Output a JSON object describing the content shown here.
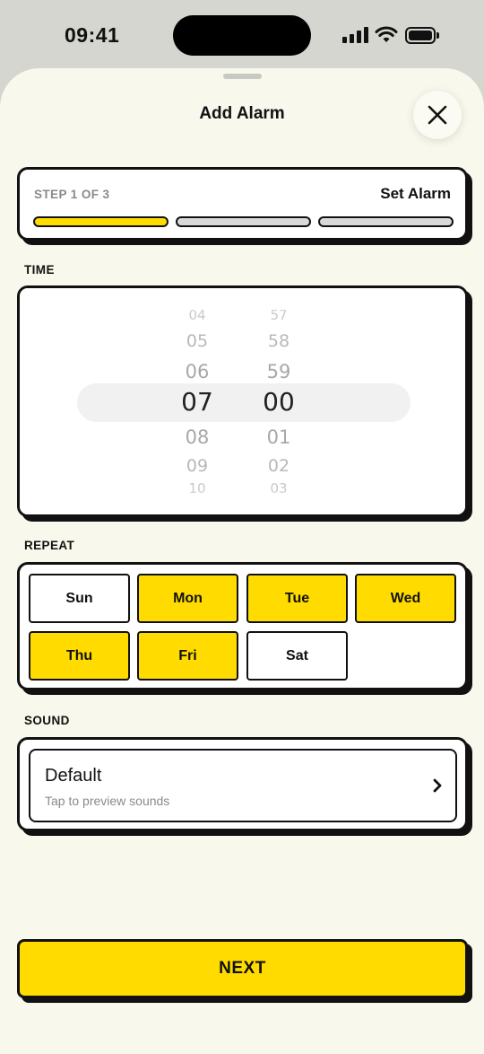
{
  "status_bar": {
    "time": "09:41"
  },
  "sheet": {
    "title": "Add Alarm"
  },
  "step": {
    "label": "STEP 1 OF 3",
    "title": "Set Alarm",
    "current": 1,
    "total": 3
  },
  "time_section": {
    "label": "TIME",
    "hours": {
      "above": [
        "04",
        "05",
        "06"
      ],
      "selected": "07",
      "below": [
        "08",
        "09",
        "10"
      ]
    },
    "minutes": {
      "above": [
        "57",
        "58",
        "59"
      ],
      "selected": "00",
      "below": [
        "01",
        "02",
        "03"
      ]
    }
  },
  "repeat": {
    "label": "REPEAT",
    "days": [
      {
        "label": "Sun",
        "selected": false
      },
      {
        "label": "Mon",
        "selected": true
      },
      {
        "label": "Tue",
        "selected": true
      },
      {
        "label": "Wed",
        "selected": true
      },
      {
        "label": "Thu",
        "selected": true
      },
      {
        "label": "Fri",
        "selected": true
      },
      {
        "label": "Sat",
        "selected": false
      }
    ]
  },
  "sound": {
    "label": "SOUND",
    "name": "Default",
    "subtitle": "Tap to preview sounds"
  },
  "next_button": {
    "label": "NEXT"
  },
  "colors": {
    "accent": "#ffdb00",
    "sheet_background": "#f8f8ec",
    "outline": "#111111"
  },
  "icons": {
    "close": "close-icon",
    "chevron": "chevron-right-icon"
  }
}
